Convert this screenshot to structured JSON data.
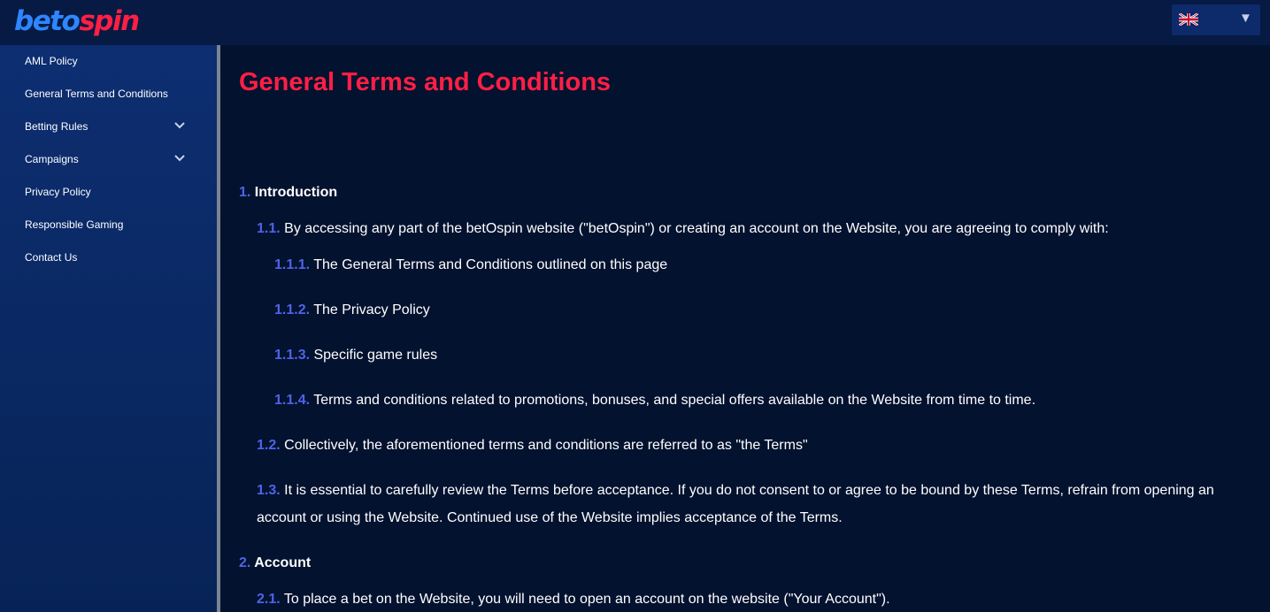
{
  "header": {
    "logo_part1": "beto",
    "logo_part2": "spin",
    "language_caret": "▼"
  },
  "sidebar": {
    "items": [
      {
        "label": "AML Policy",
        "expandable": false
      },
      {
        "label": "General Terms and Conditions",
        "expandable": false
      },
      {
        "label": "Betting Rules",
        "expandable": true
      },
      {
        "label": "Campaigns",
        "expandable": true
      },
      {
        "label": "Privacy Policy",
        "expandable": false
      },
      {
        "label": "Responsible Gaming",
        "expandable": false
      },
      {
        "label": "Contact Us",
        "expandable": false
      }
    ]
  },
  "content": {
    "title": "General Terms and Conditions",
    "sections": [
      {
        "num": "1.",
        "heading": "Introduction",
        "items": [
          {
            "num": "1.1.",
            "text": "By accessing any part of the betOspin website (\"betOspin\") or creating an account on the Website, you are agreeing to comply with:",
            "subitems": [
              {
                "num": "1.1.1.",
                "text": "The General Terms and Conditions outlined on this page"
              },
              {
                "num": "1.1.2.",
                "text": "The Privacy Policy"
              },
              {
                "num": "1.1.3.",
                "text": "Specific game rules"
              },
              {
                "num": "1.1.4.",
                "text": "Terms and conditions related to promotions, bonuses, and special offers available on the Website from time to time."
              }
            ]
          },
          {
            "num": "1.2.",
            "text": "Collectively, the aforementioned terms and conditions are referred to as \"the Terms\""
          },
          {
            "num": "1.3.",
            "text": "It is essential to carefully review the Terms before acceptance. If you do not consent to or agree to be bound by these Terms, refrain from opening an account or using the Website. Continued use of the Website implies acceptance of the Terms."
          }
        ]
      },
      {
        "num": "2.",
        "heading": "Account",
        "items": [
          {
            "num": "2.1.",
            "text": " To place a bet on the Website, you will need to open an account on the website (\"Your Account\")."
          }
        ]
      }
    ]
  },
  "colors": {
    "accent_red": "#ff1f45",
    "number_blue": "#4f63e8",
    "background": "#03122f",
    "sidebar": "#0d2e71"
  }
}
